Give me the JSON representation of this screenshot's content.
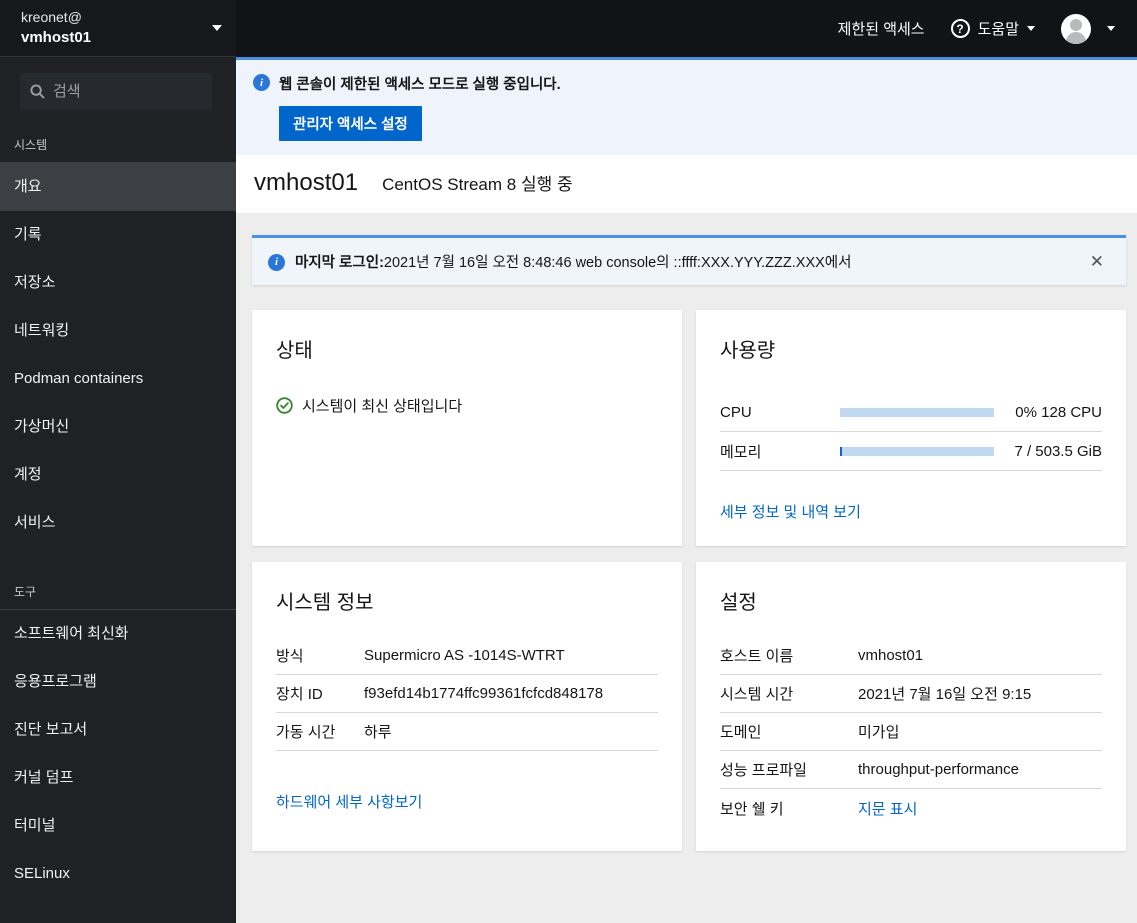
{
  "colors": {
    "accent_blue": "#0066cc",
    "banner_border_blue": "#4a90e2",
    "progress_track": "#c1d8f0",
    "progress_fill": "#0f62c9",
    "success_green": "#3e8635",
    "sidebar_bg": "#1f2125",
    "masthead_bg": "#121316"
  },
  "host_switcher": {
    "user": "kreonet@",
    "host": "vmhost01"
  },
  "masthead": {
    "restricted_access": "제한된 액세스",
    "help": "도움말"
  },
  "sidebar": {
    "search_placeholder": "검색",
    "sections": [
      {
        "label": "시스템",
        "items": [
          {
            "label": "개요"
          },
          {
            "label": "기록"
          },
          {
            "label": "저장소"
          },
          {
            "label": "네트워킹"
          },
          {
            "label": "Podman containers"
          },
          {
            "label": "가상머신"
          },
          {
            "label": "계정"
          },
          {
            "label": "서비스"
          }
        ]
      },
      {
        "label": "도구",
        "items": [
          {
            "label": "소프트웨어 최신화"
          },
          {
            "label": "응용프로그램"
          },
          {
            "label": "진단 보고서"
          },
          {
            "label": "커널 덤프"
          },
          {
            "label": "터미널"
          },
          {
            "label": "SELinux"
          }
        ]
      }
    ]
  },
  "banner": {
    "message": "웹 콘솔이 제한된 액세스 모드로 실행 중입니다.",
    "button_label": "관리자 액세스 설정"
  },
  "page": {
    "title": "vmhost01",
    "subtitle": "CentOS Stream 8 실행 중"
  },
  "alert": {
    "label": "마지막 로그인:",
    "message": "2021년 7월 16일 오전 8:48:46 web console의 ::ffff:XXX.YYY.ZZZ.XXX에서",
    "close": "✕"
  },
  "status_card": {
    "title": "상태",
    "message": "시스템이 최신 상태입니다"
  },
  "usage_card": {
    "title": "사용량",
    "rows": [
      {
        "label": "CPU",
        "value": "0% 128 CPU",
        "percent": 0
      },
      {
        "label": "메모리",
        "value": "7 / 503.5 GiB",
        "percent": 1.5
      }
    ],
    "link": "세부 정보 및 내역 보기"
  },
  "system_info_card": {
    "title": "시스템 정보",
    "rows": [
      {
        "label": "방식",
        "value": "Supermicro AS -1014S-WTRT"
      },
      {
        "label": "장치 ID",
        "value": "f93efd14b1774ffc99361fcfcd848178"
      },
      {
        "label": "가동 시간",
        "value": "하루"
      }
    ],
    "link": "하드웨어 세부 사항보기"
  },
  "settings_card": {
    "title": "설정",
    "rows": [
      {
        "label": "호스트 이름",
        "value": "vmhost01"
      },
      {
        "label": "시스템 시간",
        "value": "2021년 7월 16일 오전 9:15"
      },
      {
        "label": "도메인",
        "value": "미가입"
      },
      {
        "label": "성능 프로파일",
        "value": "throughput-performance"
      },
      {
        "label": "보안 쉘 키",
        "value": "지문 표시"
      }
    ]
  }
}
